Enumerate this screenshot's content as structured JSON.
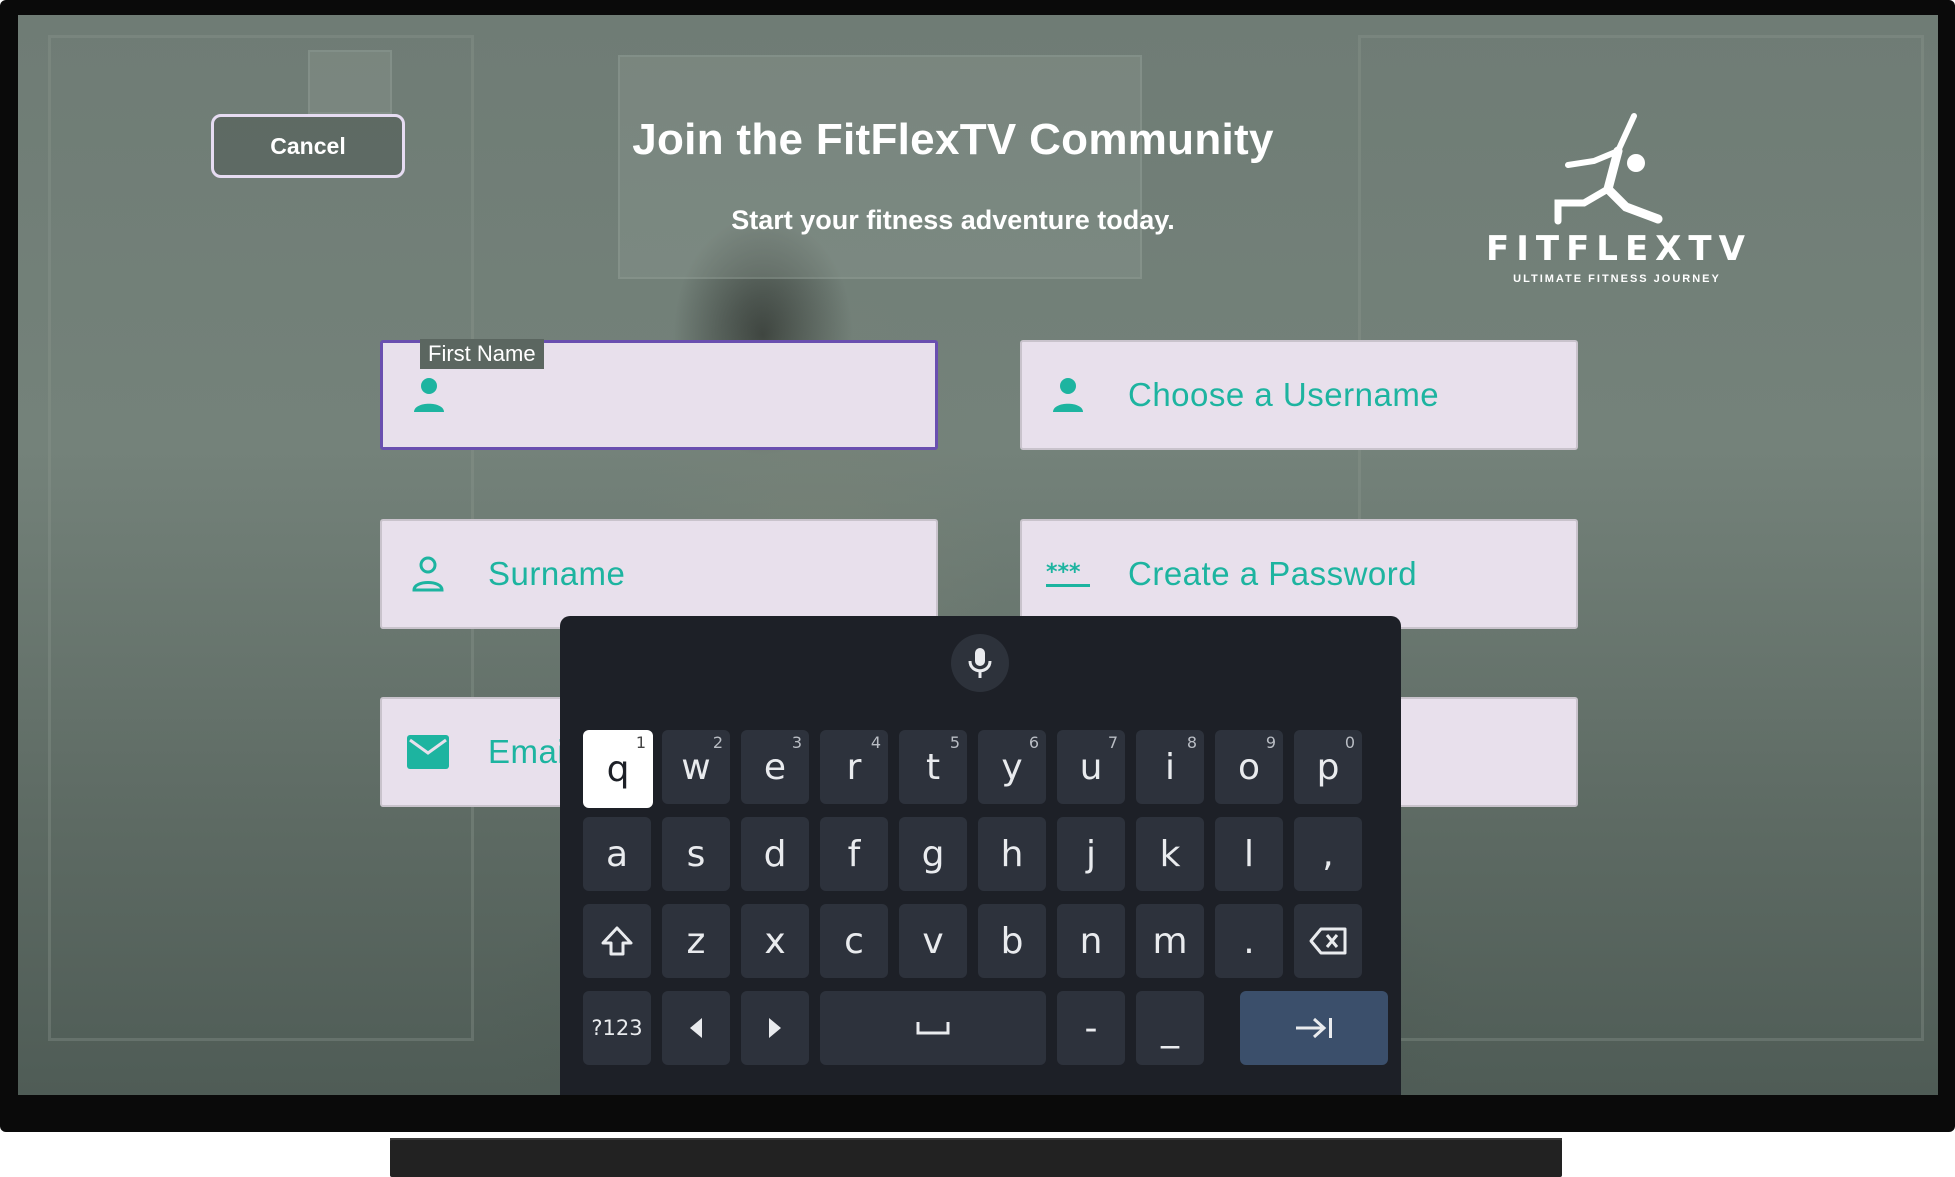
{
  "header": {
    "cancel_label": "Cancel",
    "title": "Join the FitFlexTV Community",
    "subtitle": "Start your fitness adventure today."
  },
  "logo": {
    "wordmark": "FITFLEXTV",
    "tagline": "ULTIMATE FITNESS JOURNEY"
  },
  "form": {
    "first_name": {
      "label": "First Name",
      "value": "",
      "icon": "person-icon",
      "active": true
    },
    "username": {
      "placeholder": "Choose a Username",
      "icon": "person-icon"
    },
    "surname": {
      "placeholder": "Surname",
      "icon": "person-outline-icon"
    },
    "password": {
      "placeholder": "Create a Password",
      "icon": "password-icon"
    },
    "email": {
      "placeholder": "Emai",
      "icon": "email-icon"
    },
    "hidden_field": {
      "placeholder": ""
    }
  },
  "keyboard": {
    "row1": [
      {
        "char": "q",
        "num": "1"
      },
      {
        "char": "w",
        "num": "2"
      },
      {
        "char": "e",
        "num": "3"
      },
      {
        "char": "r",
        "num": "4"
      },
      {
        "char": "t",
        "num": "5"
      },
      {
        "char": "y",
        "num": "6"
      },
      {
        "char": "u",
        "num": "7"
      },
      {
        "char": "i",
        "num": "8"
      },
      {
        "char": "o",
        "num": "9"
      },
      {
        "char": "p",
        "num": "0"
      }
    ],
    "row2": [
      "a",
      "s",
      "d",
      "f",
      "g",
      "h",
      "j",
      "k",
      "l",
      ","
    ],
    "row3": [
      "z",
      "x",
      "c",
      "v",
      "b",
      "n",
      "m",
      "."
    ],
    "symbols_label": "?123",
    "dash": "-",
    "underscore": "_",
    "focused_key": "q",
    "colors": {
      "background": "#1d2027",
      "key": "#2d323c",
      "enter": "#3b4f6b",
      "focused": "#ffffff"
    }
  },
  "colors": {
    "accent": "#1db4a0",
    "field_bg": "#e8e0ec",
    "active_border": "#6a4fb0"
  }
}
